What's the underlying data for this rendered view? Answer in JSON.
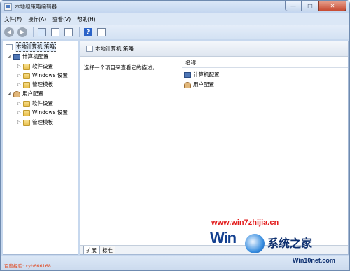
{
  "window": {
    "title": "本地组策略编辑器",
    "controls": {
      "minimize": "—",
      "maximize": "□",
      "close": "✕"
    }
  },
  "menu": [
    {
      "label": "文件(F)"
    },
    {
      "label": "操作(A)"
    },
    {
      "label": "查看(V)"
    },
    {
      "label": "帮助(H)"
    }
  ],
  "toolbar": {
    "back": "◀",
    "forward": "▶",
    "help": "?"
  },
  "tree": {
    "root": "本地计算机 策略",
    "computer": {
      "label": "计算机配置",
      "children": [
        "软件设置",
        "Windows 设置",
        "管理模板"
      ]
    },
    "user": {
      "label": "用户配置",
      "children": [
        "软件设置",
        "Windows 设置",
        "管理模板"
      ]
    }
  },
  "content": {
    "header": "本地计算机 策略",
    "description": "选择一个项目来查看它的描述。",
    "column_header": "名称",
    "items": [
      "计算机配置",
      "用户配置"
    ],
    "tabs": [
      "扩展",
      "标准"
    ]
  },
  "watermark": "百度经验: xyh666168",
  "brand": {
    "url": "www.win7zhijia.cn",
    "logo_text": "Win",
    "logo_name": "系统之家",
    "logo_site": "Win10net.com"
  }
}
